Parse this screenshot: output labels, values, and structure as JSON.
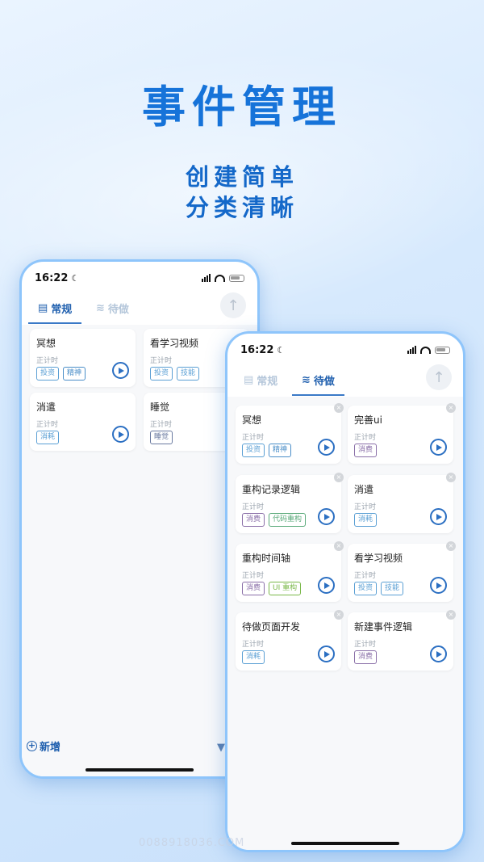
{
  "headline": "事件管理",
  "taglines": [
    "创建简单",
    "分类清晰"
  ],
  "colors": {
    "brand": "#1673d9",
    "accent_tab": "#1f5fae",
    "play": "#2b6fc2"
  },
  "watermark": "0088918036.COM",
  "phone_a": {
    "status": {
      "time": "16:22"
    },
    "tabs": [
      {
        "label": "常规",
        "icon": "list-icon",
        "active": true
      },
      {
        "label": "待做",
        "icon": "layers-icon",
        "active": false
      }
    ],
    "cards": [
      {
        "title": "冥想",
        "sub": "正计时",
        "tags": [
          {
            "text": "投资",
            "color": "#5a9fd4"
          },
          {
            "text": "精神",
            "color": "#4a8ec8"
          }
        ]
      },
      {
        "title": "看学习视频",
        "sub": "正计时",
        "tags": [
          {
            "text": "投资",
            "color": "#5a9fd4"
          },
          {
            "text": "技能",
            "color": "#5a9fd4"
          }
        ]
      },
      {
        "title": "消遣",
        "sub": "正计时",
        "tags": [
          {
            "text": "消耗",
            "color": "#5a9fd4"
          }
        ]
      },
      {
        "title": "睡觉",
        "sub": "正计时",
        "tags": [
          {
            "text": "睡觉",
            "color": "#6a7aa0"
          }
        ]
      }
    ],
    "add_label": "新增"
  },
  "phone_b": {
    "status": {
      "time": "16:22"
    },
    "tabs": [
      {
        "label": "常规",
        "icon": "list-icon",
        "active": false
      },
      {
        "label": "待做",
        "icon": "layers-icon",
        "active": true
      }
    ],
    "cards": [
      {
        "title": "冥想",
        "sub": "正计时",
        "tags": [
          {
            "text": "投资",
            "color": "#5a9fd4"
          },
          {
            "text": "精神",
            "color": "#4a8ec8"
          }
        ]
      },
      {
        "title": "完善ui",
        "sub": "正计时",
        "tags": [
          {
            "text": "消费",
            "color": "#8a6fa8"
          }
        ]
      },
      {
        "title": "重构记录逻辑",
        "sub": "正计时",
        "tags": [
          {
            "text": "消费",
            "color": "#8a6fa8"
          },
          {
            "text": "代码重构",
            "color": "#5aaa7a"
          }
        ]
      },
      {
        "title": "消遣",
        "sub": "正计时",
        "tags": [
          {
            "text": "消耗",
            "color": "#5a9fd4"
          }
        ]
      },
      {
        "title": "重构时间轴",
        "sub": "正计时",
        "tags": [
          {
            "text": "消费",
            "color": "#8a6fa8"
          },
          {
            "text": "UI 重构",
            "color": "#7ab84a"
          }
        ]
      },
      {
        "title": "看学习视频",
        "sub": "正计时",
        "tags": [
          {
            "text": "投资",
            "color": "#5a9fd4"
          },
          {
            "text": "技能",
            "color": "#5a9fd4"
          }
        ]
      },
      {
        "title": "待做页面开发",
        "sub": "正计时",
        "tags": [
          {
            "text": "消耗",
            "color": "#5a9fd4"
          }
        ]
      },
      {
        "title": "新建事件逻辑",
        "sub": "正计时",
        "tags": [
          {
            "text": "消费",
            "color": "#8a6fa8"
          }
        ]
      }
    ]
  }
}
